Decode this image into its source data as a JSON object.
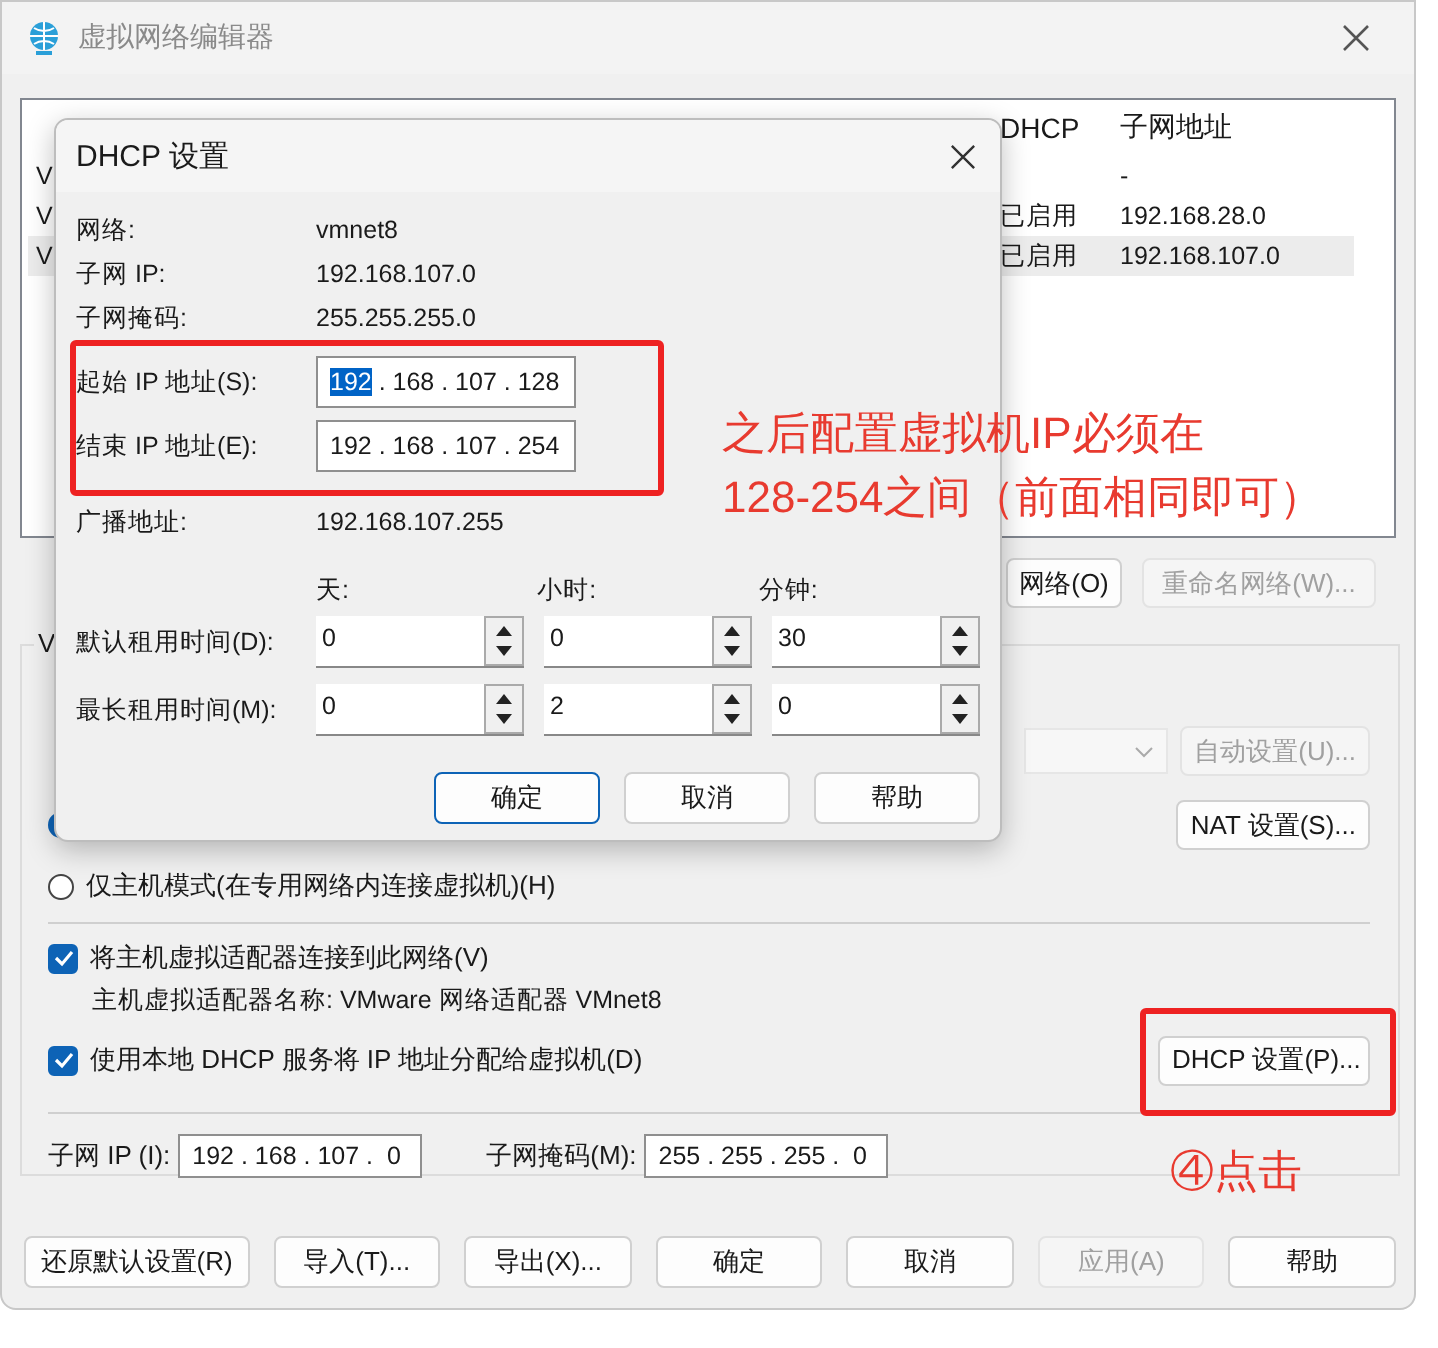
{
  "window": {
    "title": "虚拟网络编辑器"
  },
  "network_list": {
    "columns": [
      "DHCP",
      "子网地址"
    ],
    "rows": [
      {
        "column_1": "V",
        "dhcp": "",
        "subnet": "-",
        "selected": false
      },
      {
        "column_1": "V",
        "dhcp": "已启用",
        "subnet": "192.168.28.0",
        "selected": false
      },
      {
        "column_1": "V",
        "dhcp": "已启用",
        "subnet": "192.168.107.0",
        "selected": true
      }
    ]
  },
  "list_buttons": [
    {
      "label": "网络(O)",
      "disabled": false
    },
    {
      "label": "重命名网络(W)...",
      "disabled": true
    }
  ],
  "group": {
    "legend": "V",
    "auto_button": {
      "label": "自动设置(U)...",
      "disabled": true
    },
    "nat_button": "NAT 设置(S)...",
    "radios": [
      {
        "selected": true
      },
      {
        "label": "仅主机模式(在专用网络内连接虚拟机)(H)",
        "selected": false
      }
    ],
    "connect_adapter": {
      "label": "将主机虚拟适配器连接到此网络(V)",
      "checked": true
    },
    "adapter_name": "主机虚拟适配器名称: VMware 网络适配器 VMnet8",
    "use_dhcp": {
      "label": "使用本地 DHCP 服务将 IP 地址分配给虚拟机(D)",
      "checked": true
    },
    "dhcp_button": "DHCP 设置(P)...",
    "subnet_ip_label": "子网 IP (I):",
    "subnet_ip": "192 . 168 . 107 .  0",
    "subnet_mask_label": "子网掩码(M):",
    "subnet_mask": "255 . 255 . 255 .  0"
  },
  "buttons": [
    {
      "label": "还原默认设置(R)",
      "disabled": false
    },
    {
      "label": "导入(T)...",
      "disabled": false
    },
    {
      "label": "导出(X)...",
      "disabled": false
    },
    {
      "label": "确定",
      "disabled": false
    },
    {
      "label": "取消",
      "disabled": false
    },
    {
      "label": "应用(A)",
      "disabled": true
    },
    {
      "label": "帮助",
      "disabled": false
    }
  ],
  "dhcp_dialog": {
    "title": "DHCP 设置",
    "info_top": [
      {
        "label": "网络:",
        "value": "vmnet8"
      },
      {
        "label": "子网 IP:",
        "value": "192.168.107.0"
      },
      {
        "label": "子网掩码:",
        "value": "255.255.255.0"
      }
    ],
    "ip_fields": [
      {
        "label": "起始 IP 地址(S):",
        "parts": [
          {
            "text": "192",
            "selected": true
          },
          {
            "text": " . 168 . 107 . 128",
            "selected": false
          }
        ]
      },
      {
        "label": "结束 IP 地址(E):",
        "parts": [
          {
            "text": "192 . 168 . 107 . 254",
            "selected": false
          }
        ]
      }
    ],
    "info_bottom": [
      {
        "label": "广播地址:",
        "value": "192.168.107.255"
      }
    ],
    "lease_units": [
      "天:",
      "小时:",
      "分钟:"
    ],
    "leases": [
      {
        "label": "默认租用时间(D):",
        "values": [
          "0",
          "0",
          "30"
        ]
      },
      {
        "label": "最长租用时间(M):",
        "values": [
          "0",
          "2",
          "0"
        ]
      }
    ],
    "buttons": [
      {
        "label": "确定",
        "default": true
      },
      {
        "label": "取消",
        "default": false
      },
      {
        "label": "帮助",
        "default": false
      }
    ]
  },
  "annotations": {
    "note_lines": [
      "之后配置虚拟机IP必须在",
      "128-254之间（前面相同即可）"
    ],
    "step": "④点击"
  }
}
